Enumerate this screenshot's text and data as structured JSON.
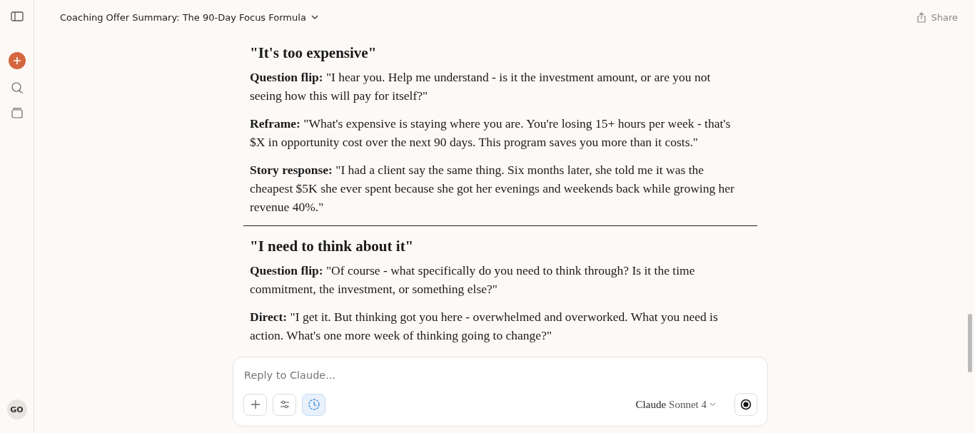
{
  "header": {
    "title": "Coaching Offer Summary: The 90-Day Focus Formula",
    "share": "Share"
  },
  "sidebar": {
    "avatar": "GO"
  },
  "sections": [
    {
      "heading": "\"It's too expensive\"",
      "paragraphs": [
        "**Question flip:** \"I hear you. Help me understand - is it the investment amount, or are you not seeing how this will pay for itself?\"",
        "**Reframe:** \"What's expensive is staying where you are. You're losing 15+ hours per week - that's $X in opportunity cost over the next 90 days. This program saves you more than it costs.\"",
        "**Story response:** \"I had a client say the same thing. Six months later, she told me it was the cheapest $5K she ever spent because she got her evenings and weekends back while growing her revenue 40%.\""
      ]
    },
    {
      "heading": "\"I need to think about it\"",
      "paragraphs": [
        "**Question flip:** \"Of course - what specifically do you need to think through? Is it the time commitment, the investment, or something else?\"",
        "**Direct:** \"I get it. But thinking got you here - overwhelmed and overworked. What you need is action. What's one more week of thinking going to change?\""
      ]
    }
  ],
  "composer": {
    "placeholder": "Reply to Claude...",
    "tools": [
      {
        "kind": "add",
        "selected": false
      },
      {
        "kind": "settings",
        "selected": false
      },
      {
        "kind": "clock",
        "selected": true
      }
    ],
    "model_brand": "Claude",
    "model_name": "Sonnet 4"
  }
}
